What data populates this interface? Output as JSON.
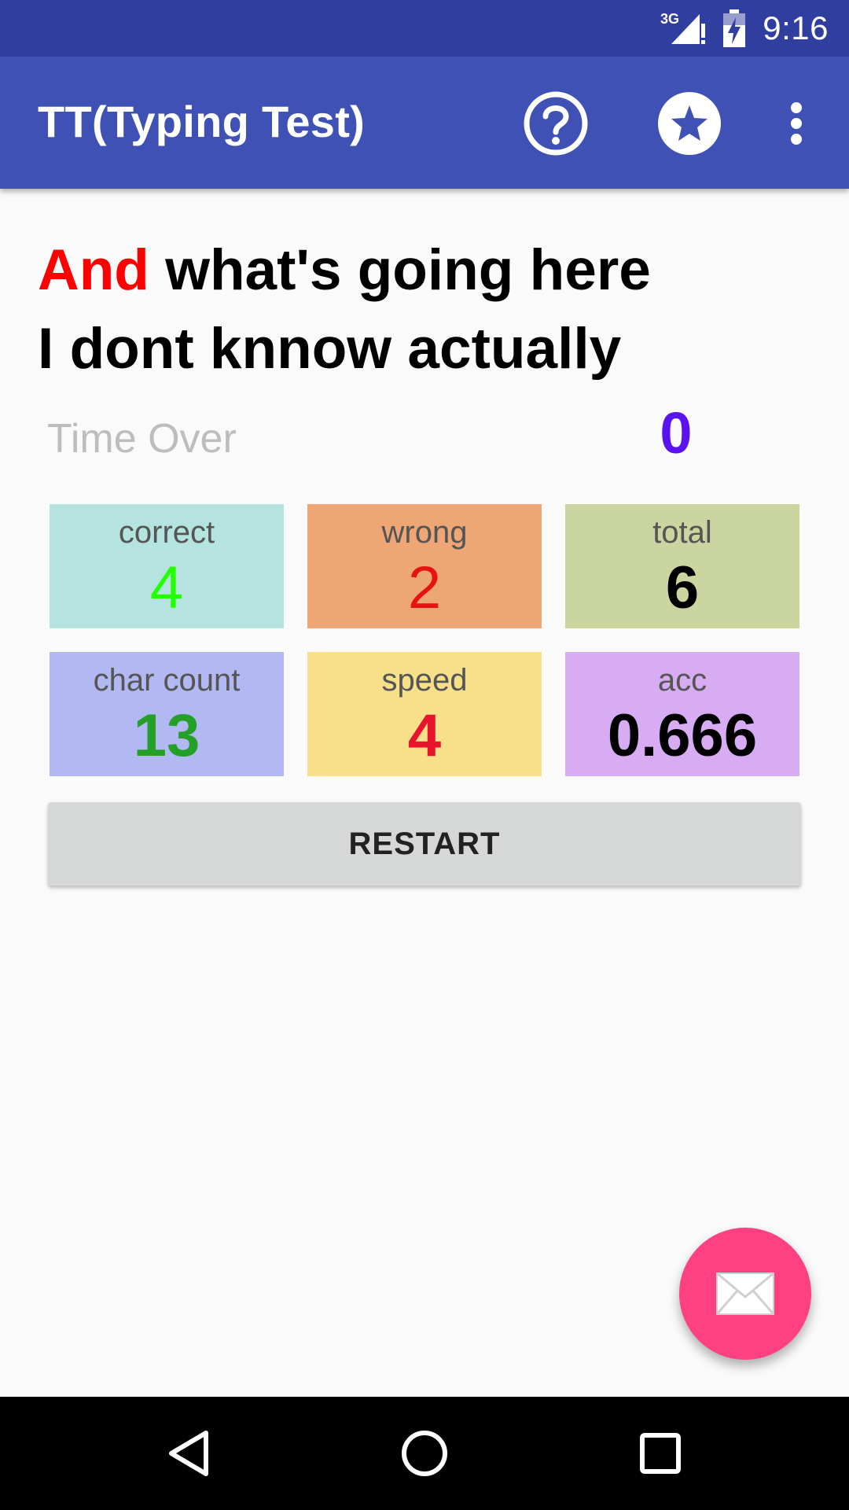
{
  "status_bar": {
    "network": "3G",
    "time": "9:16",
    "icons": [
      "signal-icon",
      "battery-charging-icon"
    ]
  },
  "app_bar": {
    "title": "TT(Typing Test)",
    "actions": [
      "help-icon",
      "star-icon",
      "more-vert-icon"
    ]
  },
  "sentence": {
    "current_word": "And",
    "rest_line1": " what's going here",
    "line2": "I dont knnow actually"
  },
  "timer": {
    "label": "Time Over",
    "value": "0"
  },
  "stats": {
    "correct": {
      "label": "correct",
      "value": "4"
    },
    "wrong": {
      "label": "wrong",
      "value": "2"
    },
    "total": {
      "label": "total",
      "value": "6"
    },
    "char_count": {
      "label": "char count",
      "value": "13"
    },
    "speed": {
      "label": "speed",
      "value": "4"
    },
    "acc": {
      "label": "acc",
      "value": "0.666"
    }
  },
  "restart_label": "RESTART",
  "fab_icon": "mail-icon",
  "nav_bar": {
    "icons": [
      "back-icon",
      "home-icon",
      "recents-icon"
    ]
  },
  "colors": {
    "primary": "#3f51b5",
    "primary_dark": "#303f9f",
    "accent": "#ff4081",
    "current_word": "#ff0000",
    "timer": "#5a12f0"
  }
}
